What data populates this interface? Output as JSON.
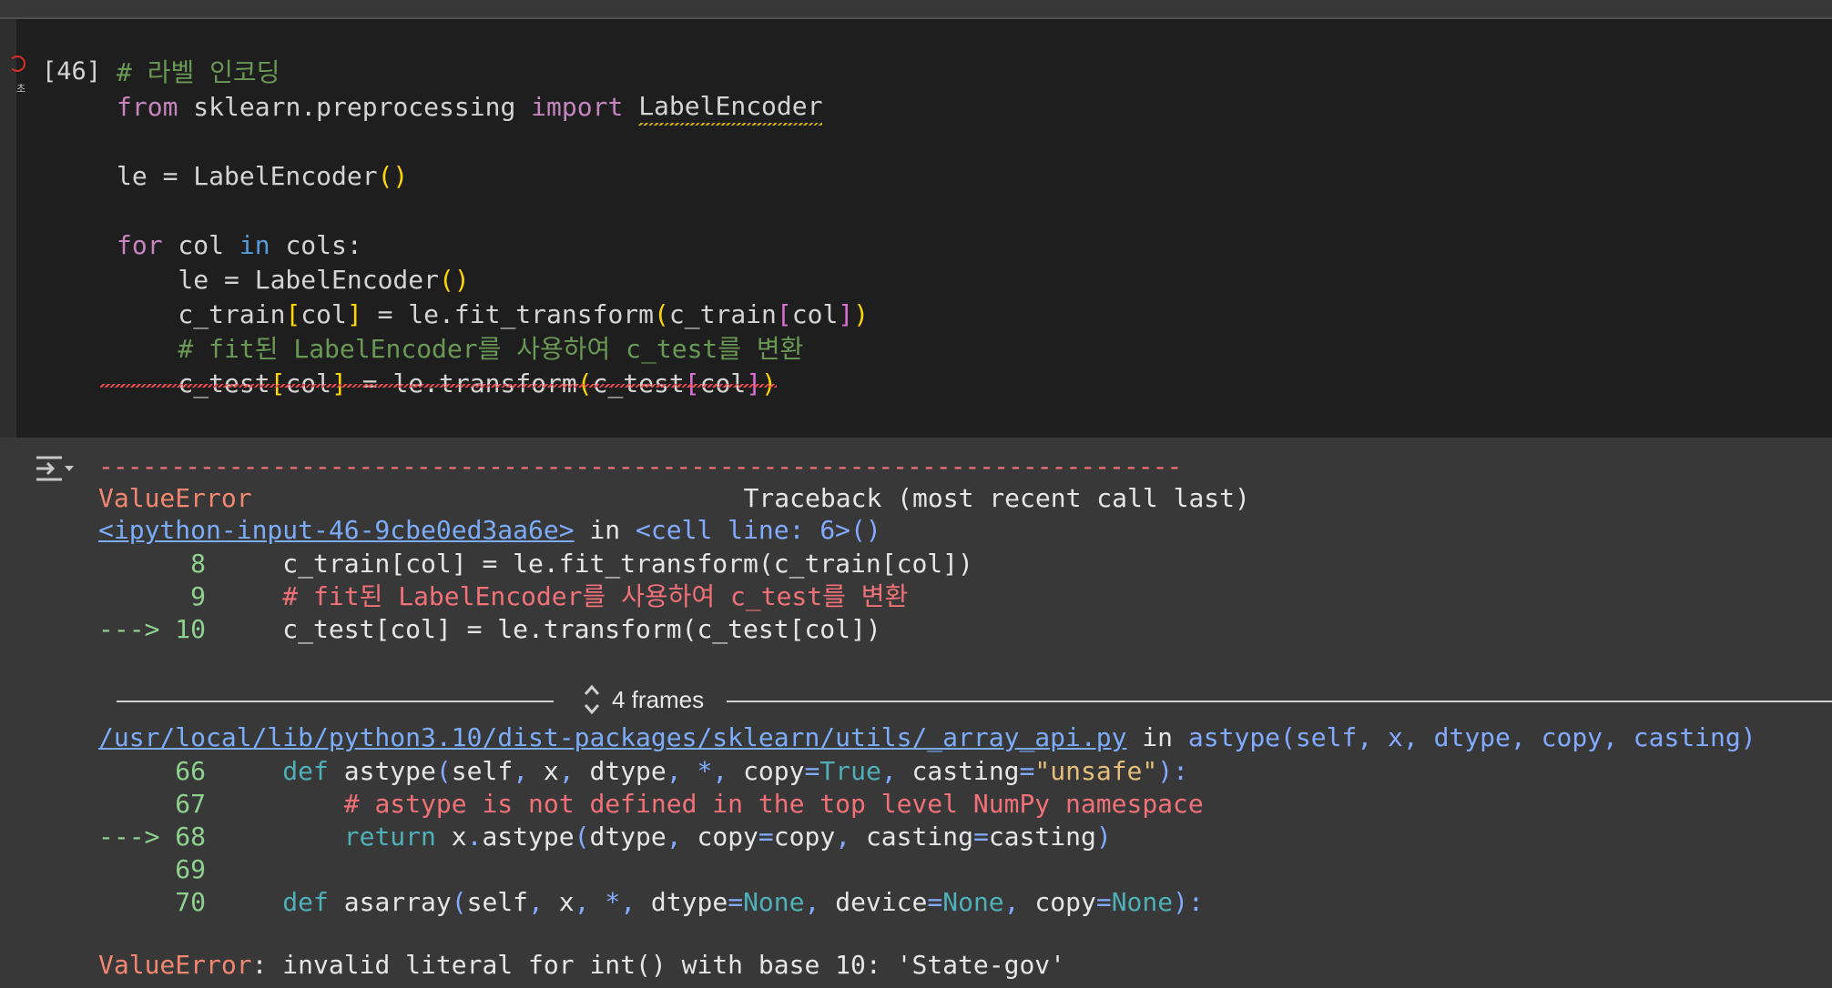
{
  "cell": {
    "exec_count": "[46]",
    "run_mark": "초",
    "code_lines": [
      {
        "tokens": [
          {
            "t": "# 라벨 인코딩",
            "c": "comment"
          }
        ]
      },
      {
        "tokens": [
          {
            "t": "from",
            "c": "import"
          },
          {
            "t": " sklearn.preprocessing ",
            "c": "name"
          },
          {
            "t": "import",
            "c": "import"
          },
          {
            "t": " ",
            "c": "name"
          },
          {
            "t": "LabelEncoder",
            "c": "warn"
          }
        ]
      },
      {
        "tokens": []
      },
      {
        "tokens": [
          {
            "t": "le = LabelEncoder",
            "c": "name"
          },
          {
            "t": "()",
            "c": "b1"
          }
        ]
      },
      {
        "tokens": []
      },
      {
        "tokens": [
          {
            "t": "for",
            "c": "import"
          },
          {
            "t": " col ",
            "c": "name"
          },
          {
            "t": "in",
            "c": "ctrl"
          },
          {
            "t": " cols:",
            "c": "name"
          }
        ]
      },
      {
        "tokens": [
          {
            "t": "    le = LabelEncoder",
            "c": "name"
          },
          {
            "t": "()",
            "c": "b1"
          }
        ]
      },
      {
        "tokens": [
          {
            "t": "    c_train",
            "c": "name"
          },
          {
            "t": "[",
            "c": "b1"
          },
          {
            "t": "col",
            "c": "name"
          },
          {
            "t": "]",
            "c": "b1"
          },
          {
            "t": " = le.fit_transform",
            "c": "name"
          },
          {
            "t": "(",
            "c": "b1"
          },
          {
            "t": "c_train",
            "c": "name"
          },
          {
            "t": "[",
            "c": "b2"
          },
          {
            "t": "col",
            "c": "name"
          },
          {
            "t": "]",
            "c": "b2"
          },
          {
            "t": ")",
            "c": "b1"
          }
        ]
      },
      {
        "tokens": [
          {
            "t": "    # fit된 LabelEncoder를 사용하여 c_test를 변환",
            "c": "comment"
          }
        ]
      },
      {
        "tokens": [
          {
            "t": "    c_test",
            "c": "name"
          },
          {
            "t": "[",
            "c": "b1"
          },
          {
            "t": "col",
            "c": "name"
          },
          {
            "t": "]",
            "c": "b1"
          },
          {
            "t": " = le.transform",
            "c": "name"
          },
          {
            "t": "(",
            "c": "b1"
          },
          {
            "t": "c_test",
            "c": "name"
          },
          {
            "t": "[",
            "c": "b2"
          },
          {
            "t": "col",
            "c": "name"
          },
          {
            "t": "]",
            "c": "b2"
          },
          {
            "t": ")",
            "c": "b1"
          }
        ]
      }
    ]
  },
  "output": {
    "dashes": "---------------------------------------------------------------------------",
    "error_type": "ValueError",
    "traceback_header": "Traceback (most recent call last)",
    "frame1_link": "<ipython-input-46-9cbe0ed3aa6e>",
    "frame1_in": " in ",
    "frame1_loc": "<cell line: 6>()",
    "frame1_lines": [
      {
        "no": "      8     ",
        "code": "c_train[col] = le.fit_transform(c_train[col])",
        "type": "code"
      },
      {
        "no": "      9     ",
        "code": "# fit된 LabelEncoder를 사용하여 c_test를 변환",
        "type": "comment"
      },
      {
        "no": "---> 10     ",
        "code": "c_test[col] = le.transform(c_test[col])",
        "type": "code"
      }
    ],
    "frames_label": "4 frames",
    "frame2_link": "/usr/local/lib/python3.10/dist-packages/sklearn/utils/_array_api.py",
    "frame2_in": " in ",
    "frame2_loc": "astype(self, x, dtype, copy, casting)",
    "frame2_lines": [
      {
        "no": "     66     ",
        "segs": [
          {
            "t": "def",
            "c": "kw"
          },
          {
            "t": " astype",
            "c": "plain"
          },
          {
            "t": "(",
            "c": "punc"
          },
          {
            "t": "self",
            "c": "plain"
          },
          {
            "t": ", ",
            "c": "punc"
          },
          {
            "t": "x",
            "c": "plain"
          },
          {
            "t": ", ",
            "c": "punc"
          },
          {
            "t": "dtype",
            "c": "plain"
          },
          {
            "t": ", ",
            "c": "punc"
          },
          {
            "t": "*",
            "c": "punc"
          },
          {
            "t": ", ",
            "c": "punc"
          },
          {
            "t": "copy",
            "c": "plain"
          },
          {
            "t": "=",
            "c": "punc"
          },
          {
            "t": "True",
            "c": "const"
          },
          {
            "t": ", ",
            "c": "punc"
          },
          {
            "t": "casting",
            "c": "plain"
          },
          {
            "t": "=",
            "c": "punc"
          },
          {
            "t": "\"unsafe\"",
            "c": "str"
          },
          {
            "t": "):",
            "c": "punc"
          }
        ]
      },
      {
        "no": "     67     ",
        "segs": [
          {
            "t": "    # astype is not defined in the top level NumPy namespace",
            "c": "comment"
          }
        ]
      },
      {
        "no": "---> 68     ",
        "segs": [
          {
            "t": "    return",
            "c": "kw"
          },
          {
            "t": " x",
            "c": "plain"
          },
          {
            "t": ".",
            "c": "punc"
          },
          {
            "t": "astype",
            "c": "plain"
          },
          {
            "t": "(",
            "c": "punc"
          },
          {
            "t": "dtype",
            "c": "plain"
          },
          {
            "t": ", ",
            "c": "punc"
          },
          {
            "t": "copy",
            "c": "plain"
          },
          {
            "t": "=",
            "c": "punc"
          },
          {
            "t": "copy",
            "c": "plain"
          },
          {
            "t": ", ",
            "c": "punc"
          },
          {
            "t": "casting",
            "c": "plain"
          },
          {
            "t": "=",
            "c": "punc"
          },
          {
            "t": "casting",
            "c": "plain"
          },
          {
            "t": ")",
            "c": "punc"
          }
        ]
      },
      {
        "no": "     69     ",
        "segs": []
      },
      {
        "no": "     70     ",
        "segs": [
          {
            "t": "def",
            "c": "kw"
          },
          {
            "t": " asarray",
            "c": "plain"
          },
          {
            "t": "(",
            "c": "punc"
          },
          {
            "t": "self",
            "c": "plain"
          },
          {
            "t": ", ",
            "c": "punc"
          },
          {
            "t": "x",
            "c": "plain"
          },
          {
            "t": ", ",
            "c": "punc"
          },
          {
            "t": "*",
            "c": "punc"
          },
          {
            "t": ", ",
            "c": "punc"
          },
          {
            "t": "dtype",
            "c": "plain"
          },
          {
            "t": "=",
            "c": "punc"
          },
          {
            "t": "None",
            "c": "const"
          },
          {
            "t": ", ",
            "c": "punc"
          },
          {
            "t": "device",
            "c": "plain"
          },
          {
            "t": "=",
            "c": "punc"
          },
          {
            "t": "None",
            "c": "const"
          },
          {
            "t": ", ",
            "c": "punc"
          },
          {
            "t": "copy",
            "c": "plain"
          },
          {
            "t": "=",
            "c": "punc"
          },
          {
            "t": "None",
            "c": "const"
          },
          {
            "t": "):",
            "c": "punc"
          }
        ]
      }
    ],
    "final_error_type": "ValueError",
    "final_error_msg": ": invalid literal for int() with base 10: 'State-gov'"
  },
  "icons": {
    "run_status": "error-circle-icon",
    "output_toggle": "output-collapse-icon",
    "frames_expand": "unfold-icon"
  }
}
